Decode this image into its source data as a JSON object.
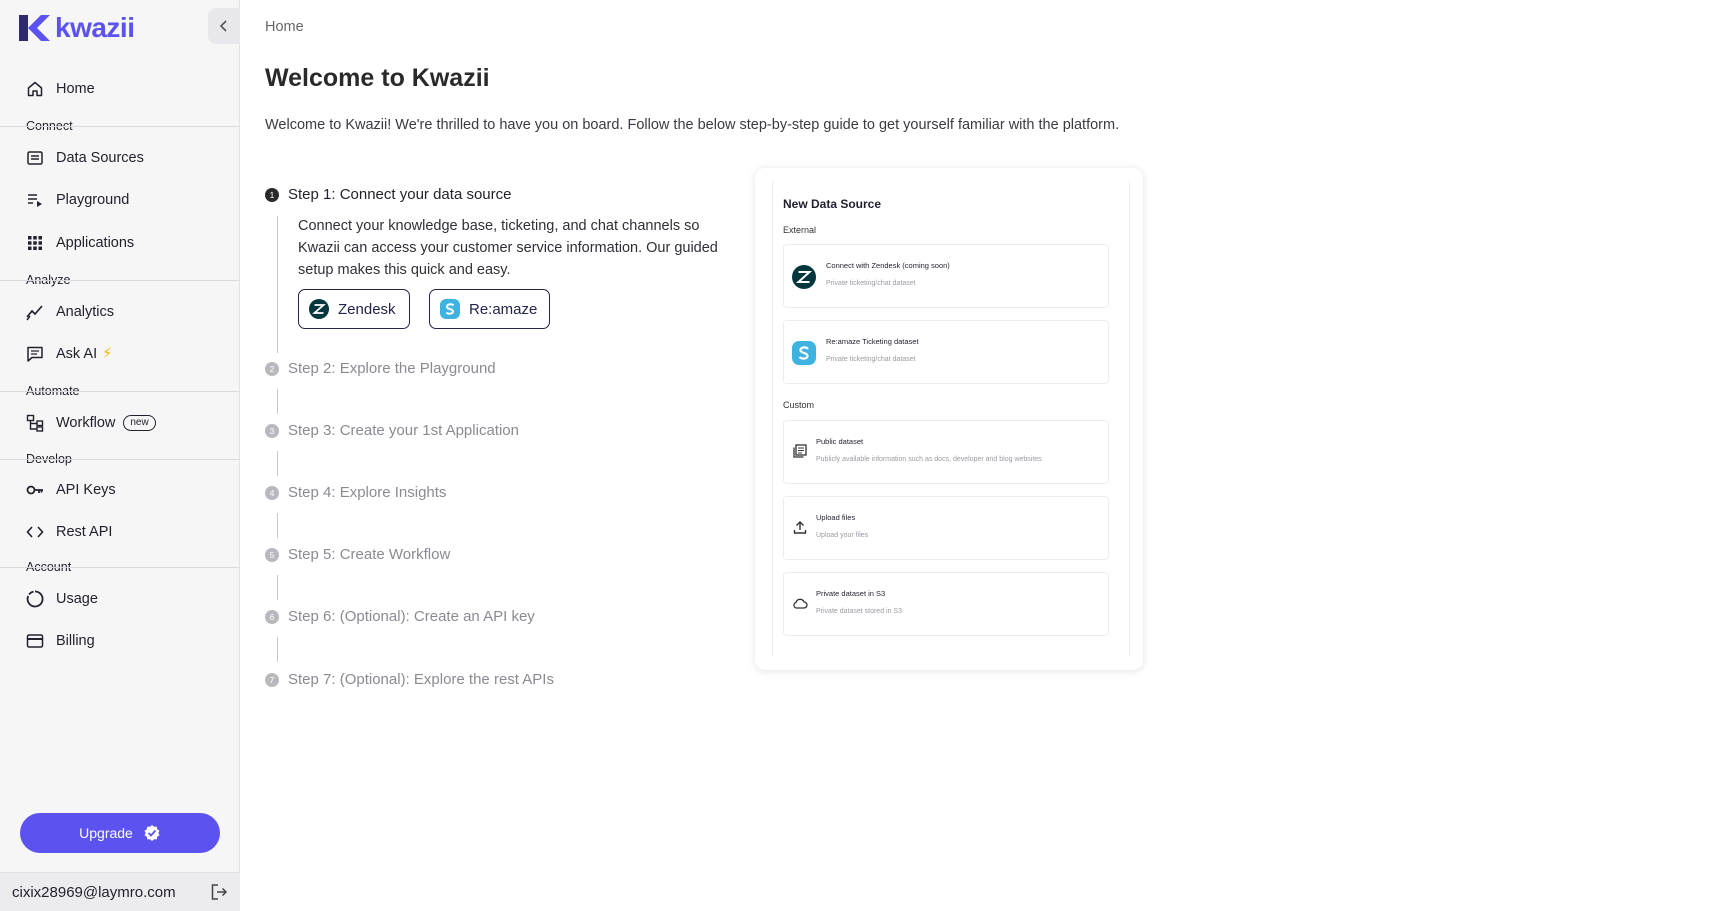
{
  "app": {
    "logo_text": "kwazii",
    "brand_color": "#5b52f0"
  },
  "sidebar": {
    "home": "Home",
    "sections": {
      "connect": "Connect",
      "analyze": "Analyze",
      "automate": "Automate",
      "develop": "Develop",
      "account": "Account"
    },
    "items": {
      "data_sources": "Data Sources",
      "playground": "Playground",
      "applications": "Applications",
      "analytics": "Analytics",
      "ask_ai": "Ask AI",
      "ask_ai_emoji": "⚡",
      "workflow": "Workflow",
      "workflow_badge": "new",
      "api_keys": "API Keys",
      "rest_api": "Rest API",
      "usage": "Usage",
      "billing": "Billing"
    },
    "upgrade_label": "Upgrade",
    "user_email": "cixix28969@laymro.com"
  },
  "main": {
    "breadcrumb": "Home",
    "title": "Welcome to Kwazii",
    "intro": "Welcome to Kwazii! We're thrilled to have you on board. Follow the below step-by-step guide to get yourself familiar with the platform.",
    "steps": [
      {
        "num": "1",
        "label": "Step 1: Connect your data source",
        "active": true
      },
      {
        "num": "2",
        "label": "Step 2: Explore the Playground"
      },
      {
        "num": "3",
        "label": "Step 3: Create your 1st Application"
      },
      {
        "num": "4",
        "label": "Step 4: Explore Insights"
      },
      {
        "num": "5",
        "label": "Step 5: Create Workflow"
      },
      {
        "num": "6",
        "label": "Step 6: (Optional): Create an API key"
      },
      {
        "num": "7",
        "label": "Step 7: (Optional): Explore the rest APIs"
      }
    ],
    "step1_desc": "Connect your knowledge base, ticketing, and chat channels so Kwazii can access your customer service information. Our guided setup makes this quick and easy.",
    "chips": {
      "zendesk": "Zendesk",
      "reamaze": "Re:amaze"
    }
  },
  "preview": {
    "title": "New Data Source",
    "external_label": "External",
    "custom_label": "Custom",
    "cards": [
      {
        "title": "Connect with Zendesk (coming soon)",
        "sub": "Private ticketing/chat dataset",
        "icon": "zendesk-icon"
      },
      {
        "title": "Re:amaze Ticketing dataset",
        "sub": "Private ticketing/chat dataset",
        "icon": "reamaze-icon"
      },
      {
        "title": "Public dataset",
        "sub": "Publicly available information such as docs, developer and blog websites",
        "icon": "library-icon"
      },
      {
        "title": "Upload files",
        "sub": "Upload your files",
        "icon": "upload-icon"
      },
      {
        "title": "Private dataset in S3",
        "sub": "Private dataset stored in S3",
        "icon": "cloud-icon"
      }
    ]
  }
}
